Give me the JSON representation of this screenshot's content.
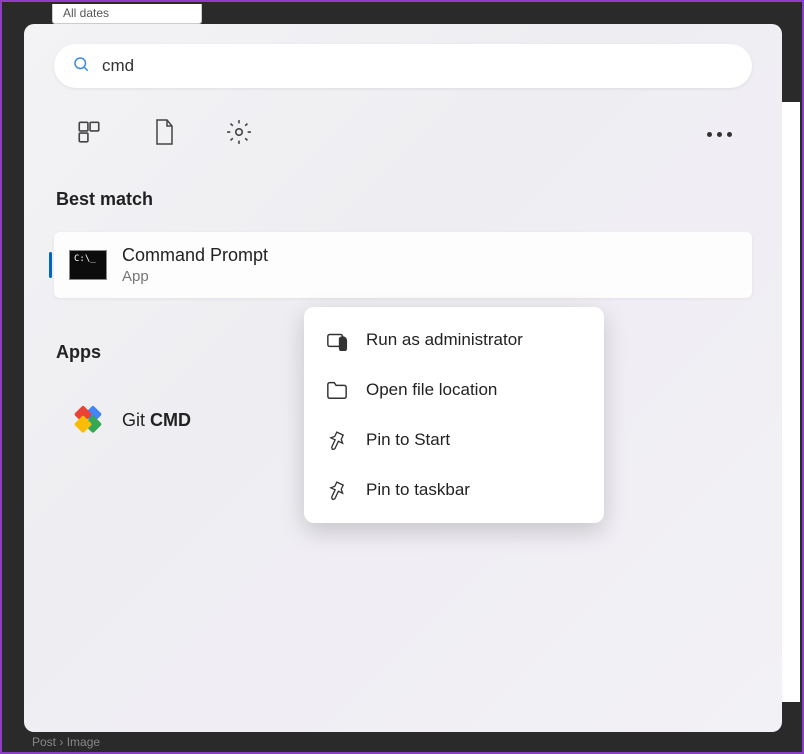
{
  "search": {
    "query": "cmd"
  },
  "dropdown_hint": "All dates",
  "sections": {
    "best_match": "Best match",
    "apps": "Apps"
  },
  "results": {
    "command_prompt": {
      "title": "Command Prompt",
      "subtitle": "App",
      "icon_text": "C:\\_"
    },
    "git_cmd": {
      "prefix": "Git ",
      "match": "CMD"
    }
  },
  "context_menu": {
    "run_admin": "Run as administrator",
    "open_location": "Open file location",
    "pin_start": "Pin to Start",
    "pin_taskbar": "Pin to taskbar"
  },
  "breadcrumb": {
    "first": "Post",
    "separator": "›",
    "second": "Image"
  }
}
